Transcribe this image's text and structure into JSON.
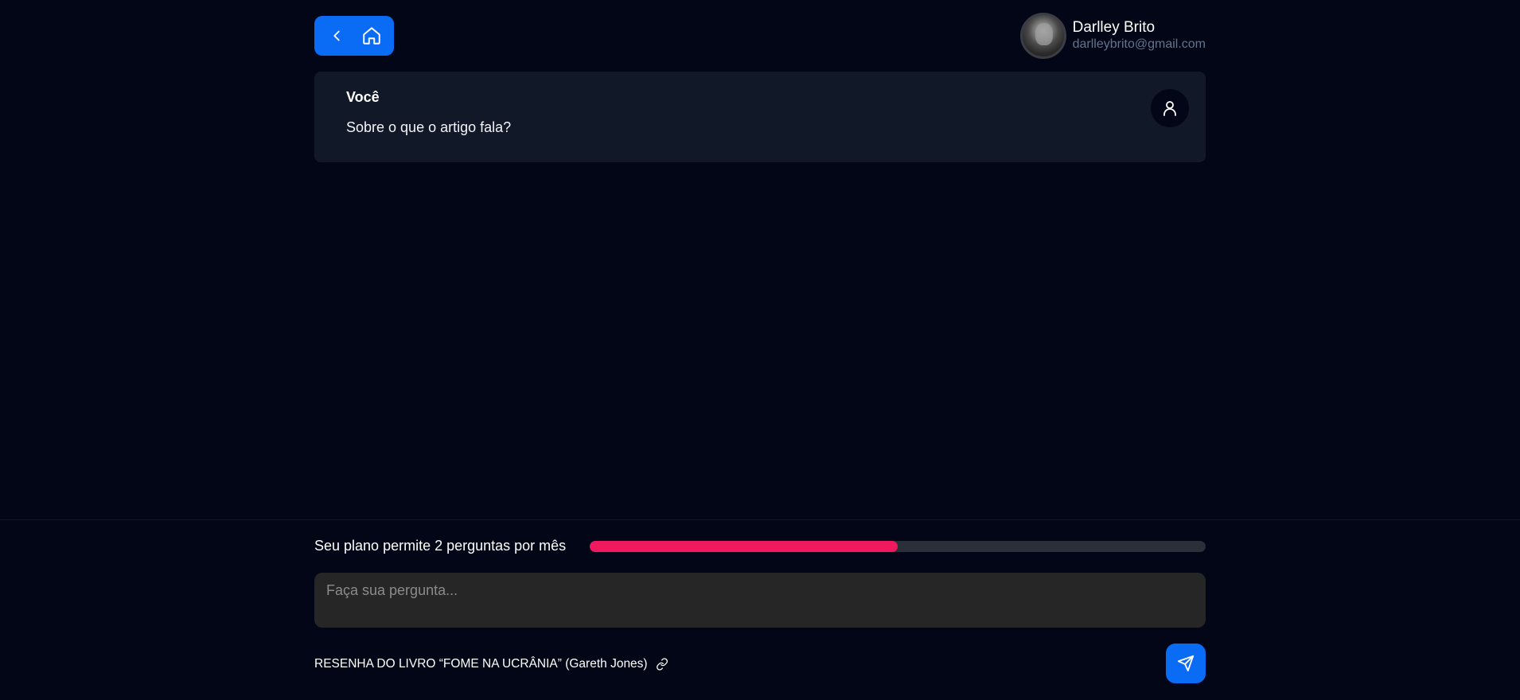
{
  "header": {
    "back_icon": "chevron-left-icon",
    "home_icon": "home-icon",
    "accent_color": "#0a6cf5"
  },
  "user": {
    "name": "Darlley Brito",
    "email": "darlleybrito@gmail.com"
  },
  "chat": {
    "messages": [
      {
        "author": "Você",
        "text": "Sobre o que o artigo fala?",
        "icon": "user-icon"
      }
    ]
  },
  "plan": {
    "text": "Seu plano permite 2 perguntas por mês",
    "usage_fraction": 0.5,
    "bar_color": "#f0185f"
  },
  "input": {
    "placeholder": "Faça sua pergunta...",
    "value": ""
  },
  "source": {
    "title": "RESENHA DO LIVRO “FOME NA UCRÂNIA” (Gareth Jones)",
    "icon": "link-icon"
  },
  "send": {
    "icon": "send-icon"
  }
}
